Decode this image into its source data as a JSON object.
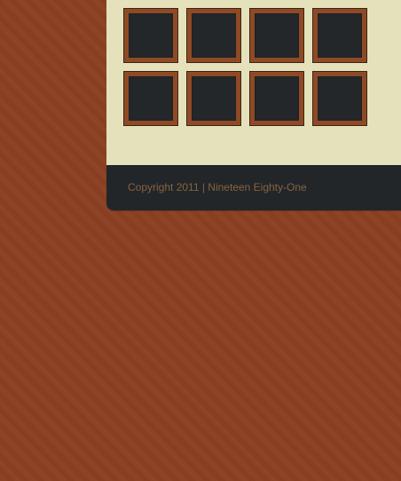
{
  "gallery": {
    "thumbnails": [
      {
        "row": 1,
        "col": 1
      },
      {
        "row": 1,
        "col": 2
      },
      {
        "row": 1,
        "col": 3
      },
      {
        "row": 1,
        "col": 4
      },
      {
        "row": 2,
        "col": 1
      },
      {
        "row": 2,
        "col": 2
      },
      {
        "row": 2,
        "col": 3
      },
      {
        "row": 2,
        "col": 4
      }
    ]
  },
  "footer": {
    "copyright": "Copyright 2011 | Nineteen Eighty-One"
  },
  "colors": {
    "background": "#8b4022",
    "panel": "#e5e2bb",
    "thumb_frame": "#8f4a25",
    "thumb_fill": "#23272a",
    "footer_bg": "#222629",
    "footer_text": "#88623f"
  }
}
